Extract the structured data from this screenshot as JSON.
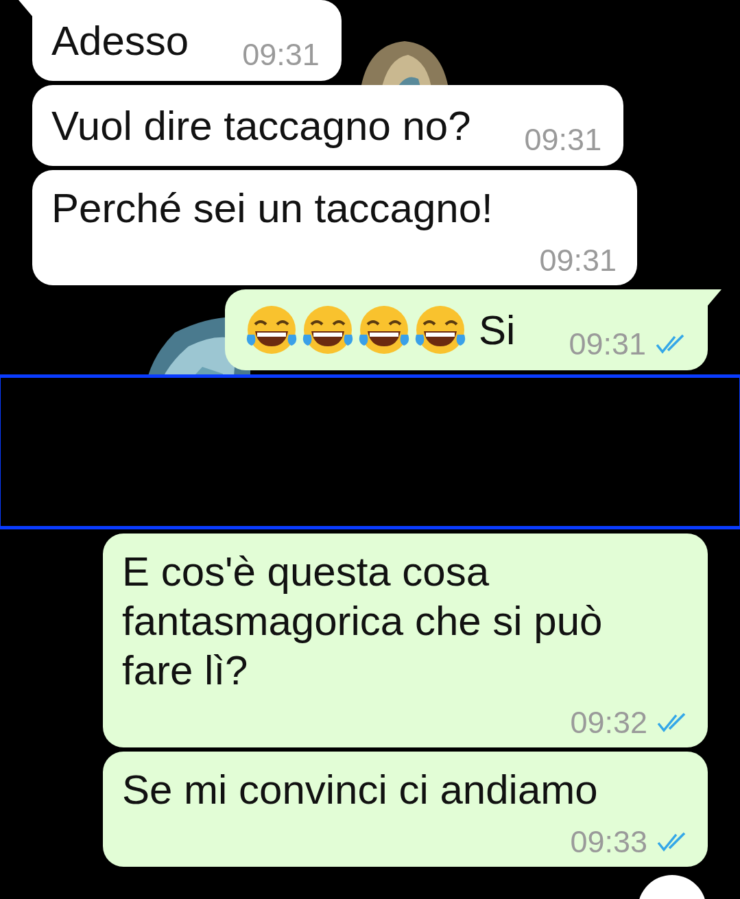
{
  "messages": [
    {
      "kind": "message",
      "outgoing": false,
      "time_below": false,
      "tail": true,
      "text": "Adesso",
      "time": "09:31"
    },
    {
      "kind": "message",
      "outgoing": false,
      "time_below": false,
      "tail": false,
      "text": "Vuol dire taccagno no?",
      "time": "09:31"
    },
    {
      "kind": "message",
      "outgoing": false,
      "time_below": true,
      "tail": false,
      "text": "Perché sei un taccagno!",
      "time": "09:31"
    },
    {
      "kind": "message",
      "outgoing": true,
      "time_below": false,
      "tail": true,
      "icons": [
        {
          "kind": "tears-of-joy"
        },
        {
          "kind": "tears-of-joy"
        },
        {
          "kind": "tears-of-joy"
        },
        {
          "kind": "tears-of-joy"
        }
      ],
      "text": "Si",
      "time": "09:31",
      "read": true
    },
    {
      "kind": "redacted"
    },
    {
      "kind": "message",
      "outgoing": true,
      "time_below": true,
      "tail": false,
      "text": "E cos'è questa cosa fantasmagorica che si può fare lì?",
      "time": "09:32",
      "read": true
    },
    {
      "kind": "message",
      "outgoing": true,
      "time_below": true,
      "tail": false,
      "text": "Se mi convinci ci andiamo",
      "time": "09:33",
      "read": true
    }
  ]
}
